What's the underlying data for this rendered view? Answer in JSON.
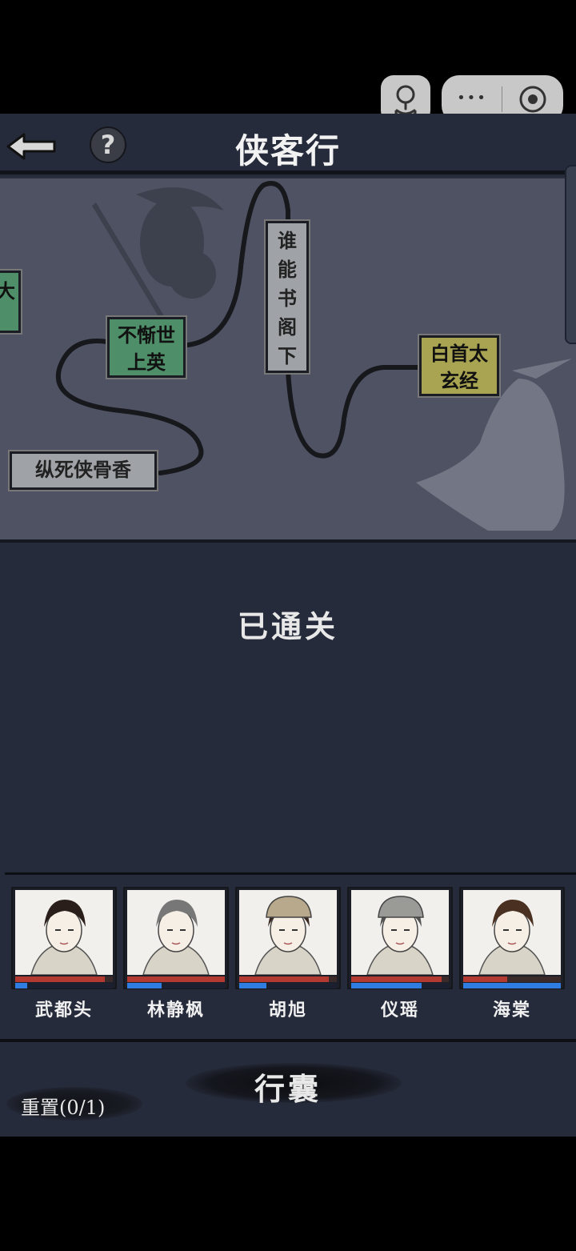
{
  "header": {
    "title": "侠客行",
    "back_icon": "back-arrow-icon",
    "help_icon": "help-icon",
    "help_glyph": "?"
  },
  "system_capsule": {
    "more_glyph": "•••",
    "close_icon": "record-icon"
  },
  "map": {
    "nodes": [
      {
        "label": "大",
        "style": "green",
        "partial": true
      },
      {
        "label": "不惭世上英",
        "style": "green"
      },
      {
        "label": "谁能书阁下",
        "style": "grey"
      },
      {
        "label": "白首太玄经",
        "style": "olive"
      },
      {
        "label": "纵死侠骨香",
        "style": "grey"
      }
    ]
  },
  "status": "已通关",
  "party": [
    {
      "name": "武都头",
      "hp": 0.92,
      "mp": 0.12
    },
    {
      "name": "林静枫",
      "hp": 1.0,
      "mp": 0.35
    },
    {
      "name": "胡旭",
      "hp": 0.92,
      "mp": 0.28
    },
    {
      "name": "仪瑶",
      "hp": 0.93,
      "mp": 0.72
    },
    {
      "name": "海棠",
      "hp": 0.45,
      "mp": 1.0
    }
  ],
  "footer": {
    "bag_label": "行囊",
    "reset_label": "重置(0/1)"
  },
  "colors": {
    "background": "#262b3b",
    "map_panel": "#4e5263",
    "hp": "#b23a30",
    "mp": "#2f7de0",
    "node_green": "#4e8f69",
    "node_grey": "#9fa2a6",
    "node_olive": "#a8a451"
  }
}
